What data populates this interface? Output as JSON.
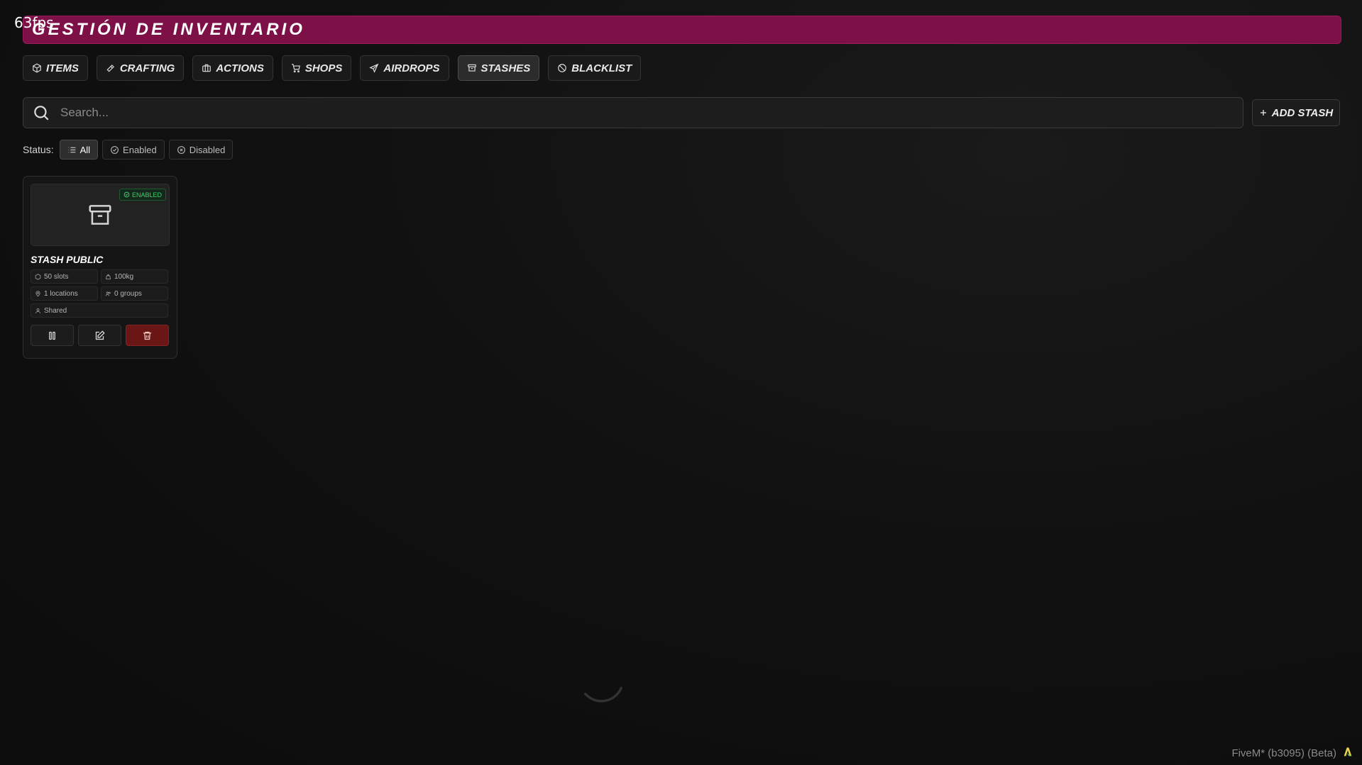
{
  "overlay": {
    "fps": "63fps"
  },
  "header": {
    "title": "GESTIÓN DE INVENTARIO"
  },
  "tabs": [
    {
      "label": "ITEMS",
      "icon": "package-icon"
    },
    {
      "label": "CRAFTING",
      "icon": "hammer-icon"
    },
    {
      "label": "ACTIONS",
      "icon": "briefcase-icon"
    },
    {
      "label": "SHOPS",
      "icon": "cart-icon"
    },
    {
      "label": "AIRDROPS",
      "icon": "plane-icon"
    },
    {
      "label": "STASHES",
      "icon": "archive-icon",
      "active": true
    },
    {
      "label": "BLACKLIST",
      "icon": "ban-icon"
    }
  ],
  "search": {
    "placeholder": "Search..."
  },
  "add_button": {
    "label": "ADD STASH"
  },
  "filters": {
    "label": "Status:",
    "options": [
      {
        "label": "All",
        "icon": "list-icon",
        "active": true
      },
      {
        "label": "Enabled",
        "icon": "check-circle-icon"
      },
      {
        "label": "Disabled",
        "icon": "x-circle-icon"
      }
    ]
  },
  "stashes": [
    {
      "name": "STASH PUBLIC",
      "status": "ENABLED",
      "slots": "50 slots",
      "weight": "100kg",
      "locations": "1 locations",
      "groups": "0 groups",
      "access": "Shared"
    }
  ],
  "footer": {
    "text": "FiveM* (b3095) (Beta)"
  },
  "colors": {
    "banner": "#7d1147",
    "background": "#111111",
    "enabled": "#3ecf6a",
    "danger": "#6b1616"
  }
}
